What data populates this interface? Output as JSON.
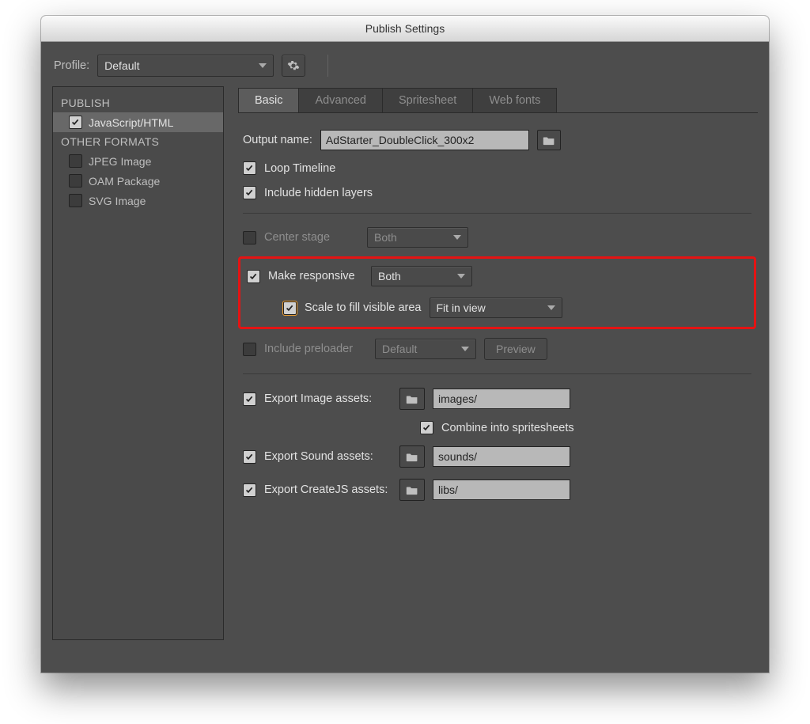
{
  "window": {
    "title": "Publish Settings"
  },
  "toolbar": {
    "profile_label": "Profile:",
    "profile_value": "Default"
  },
  "sidebar": {
    "sections": [
      {
        "heading": "PUBLISH",
        "items": [
          {
            "label": "JavaScript/HTML",
            "checked": true,
            "selected": true
          }
        ]
      },
      {
        "heading": "OTHER FORMATS",
        "items": [
          {
            "label": "JPEG Image",
            "checked": false,
            "selected": false
          },
          {
            "label": "OAM Package",
            "checked": false,
            "selected": false
          },
          {
            "label": "SVG Image",
            "checked": false,
            "selected": false
          }
        ]
      }
    ]
  },
  "tabs": {
    "items": [
      {
        "label": "Basic",
        "active": true
      },
      {
        "label": "Advanced",
        "active": false
      },
      {
        "label": "Spritesheet",
        "active": false
      },
      {
        "label": "Web fonts",
        "active": false
      }
    ]
  },
  "basic": {
    "output_name_label": "Output name:",
    "output_name_value": "AdStarter_DoubleClick_300x2",
    "loop_timeline": {
      "label": "Loop Timeline",
      "checked": true
    },
    "include_hidden": {
      "label": "Include hidden layers",
      "checked": true
    },
    "center_stage": {
      "label": "Center stage",
      "checked": false,
      "option": "Both"
    },
    "make_responsive": {
      "label": "Make responsive",
      "checked": true,
      "option": "Both"
    },
    "scale_fill": {
      "label": "Scale to fill visible area",
      "checked": true,
      "option": "Fit in view"
    },
    "include_preloader": {
      "label": "Include preloader",
      "checked": false,
      "option": "Default",
      "preview_label": "Preview"
    },
    "export_image": {
      "label": "Export Image assets:",
      "checked": true,
      "path": "images/"
    },
    "combine_spritesheets": {
      "label": "Combine into spritesheets",
      "checked": true
    },
    "export_sound": {
      "label": "Export Sound assets:",
      "checked": true,
      "path": "sounds/"
    },
    "export_createjs": {
      "label": "Export CreateJS assets:",
      "checked": true,
      "path": "libs/"
    }
  }
}
